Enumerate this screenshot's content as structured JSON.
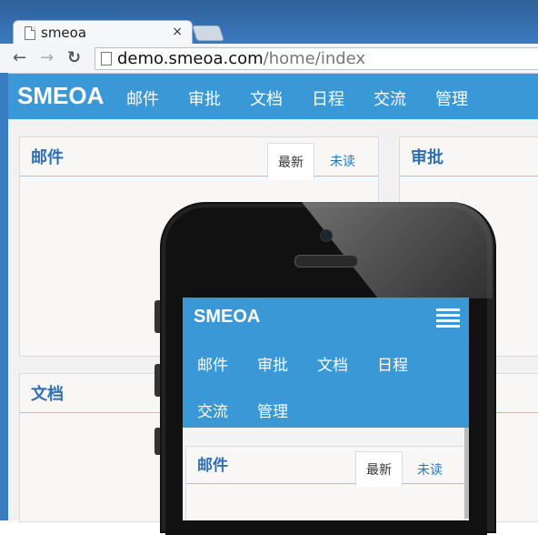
{
  "browser": {
    "tab_title": "smeoa",
    "close_glyph": "×",
    "url_host": "demo.smeoa.com",
    "url_path": "/home/index",
    "back_glyph": "←",
    "forward_glyph": "→",
    "reload_glyph": "↻"
  },
  "site": {
    "brand": "SMEOA",
    "nav": [
      "邮件",
      "审批",
      "文档",
      "日程",
      "交流",
      "管理"
    ]
  },
  "panels": {
    "mail": {
      "title": "邮件",
      "tab_latest": "最新",
      "tab_unread": "未读"
    },
    "approval": {
      "title": "审批"
    },
    "docs": {
      "title": "文档"
    }
  },
  "mobile": {
    "brand": "SMEOA",
    "menu_icon": "list-icon",
    "nav": [
      "邮件",
      "审批",
      "文档",
      "日程",
      "交流",
      "管理"
    ],
    "mail_panel": {
      "title": "邮件",
      "tab_latest": "最新",
      "tab_unread": "未读"
    }
  },
  "colors": {
    "accent": "#3a98d6",
    "title_blue": "#2f6fb5",
    "chrome": "#3a7cc0"
  }
}
